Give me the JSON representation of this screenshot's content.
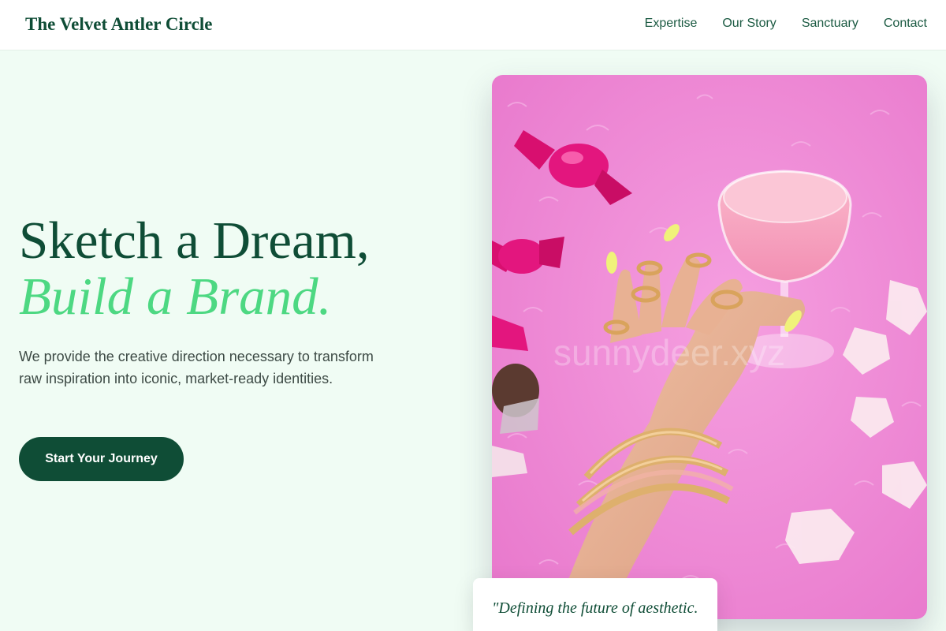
{
  "header": {
    "brand": "The Velvet Antler Circle",
    "nav": [
      "Expertise",
      "Our Story",
      "Sanctuary",
      "Contact"
    ]
  },
  "hero": {
    "title_line1": "Sketch a Dream,",
    "title_line2": "Build a Brand.",
    "description": "We provide the creative direction necessary to transform raw inspiration into iconic, market-ready identities.",
    "cta_label": "Start Your Journey"
  },
  "photo": {
    "watermark": "sunnydeer.xyz"
  },
  "quote": {
    "text": "\"Defining the future of aesthetic."
  },
  "colors": {
    "brand_dark_green": "#0f4d36",
    "accent_green": "#4dd882",
    "page_background": "#f0fcf4",
    "photo_pink": "#ef86d6",
    "candy_magenta": "#e3167e"
  }
}
